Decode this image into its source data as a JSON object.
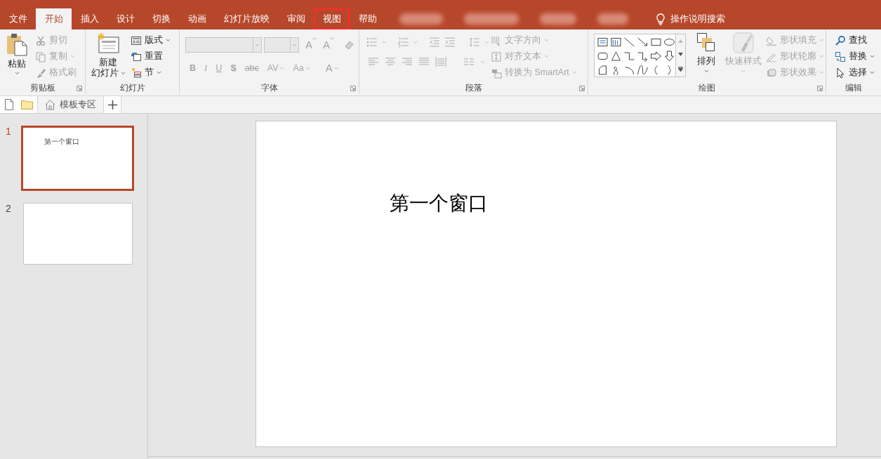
{
  "ribbon_tabs": [
    {
      "label": "文件",
      "selected": false,
      "highlighted": false
    },
    {
      "label": "开始",
      "selected": true,
      "highlighted": false
    },
    {
      "label": "插入",
      "selected": false,
      "highlighted": false
    },
    {
      "label": "设计",
      "selected": false,
      "highlighted": false
    },
    {
      "label": "切换",
      "selected": false,
      "highlighted": false
    },
    {
      "label": "动画",
      "selected": false,
      "highlighted": false
    },
    {
      "label": "幻灯片放映",
      "selected": false,
      "highlighted": false
    },
    {
      "label": "审阅",
      "selected": false,
      "highlighted": false
    },
    {
      "label": "视图",
      "selected": false,
      "highlighted": true
    },
    {
      "label": "帮助",
      "selected": false,
      "highlighted": false
    }
  ],
  "tell_me": "操作说明搜索",
  "clipboard": {
    "label": "剪贴板",
    "paste": "粘贴",
    "items": [
      {
        "label": "剪切",
        "kind": "scissors",
        "disabled": true,
        "dropdown": false
      },
      {
        "label": "复制",
        "kind": "copy",
        "disabled": true,
        "dropdown": true
      },
      {
        "label": "格式刷",
        "kind": "brush",
        "disabled": true,
        "dropdown": false
      }
    ]
  },
  "slides_group": {
    "label": "幻灯片",
    "new_slide": [
      "新建",
      "幻灯片"
    ],
    "items": [
      {
        "label": "版式",
        "kind": "layout",
        "disabled": false,
        "dropdown": true
      },
      {
        "label": "重置",
        "kind": "reset",
        "disabled": false,
        "dropdown": false
      },
      {
        "label": "节",
        "kind": "section",
        "disabled": false,
        "dropdown": true
      }
    ]
  },
  "font_group": {
    "label": "字体",
    "format_buttons": [
      {
        "label": "B",
        "kind": "bold"
      },
      {
        "label": "I",
        "kind": "italic"
      },
      {
        "label": "U",
        "kind": "underline"
      },
      {
        "label": "S",
        "kind": "shadow"
      },
      {
        "label": "abc",
        "kind": "strike"
      },
      {
        "label": "AV",
        "kind": "spacing"
      },
      {
        "label": "Aa",
        "kind": "case"
      },
      {
        "label": "A",
        "kind": "color"
      }
    ],
    "size_buttons": [
      "A",
      "A"
    ]
  },
  "paragraph_group": {
    "label": "段落",
    "items": [
      {
        "label": "文字方向",
        "kind": "direction",
        "disabled": true
      },
      {
        "label": "对齐文本",
        "kind": "align",
        "disabled": true
      },
      {
        "label": "转换为 SmartArt",
        "kind": "smartart",
        "disabled": true
      }
    ]
  },
  "drawing_group": {
    "label": "绘图",
    "arrange": "排列",
    "quick_styles": "快速样式",
    "quick_styles_disabled": true,
    "items": [
      {
        "label": "形状填充",
        "kind": "fill",
        "disabled": true
      },
      {
        "label": "形状轮廓",
        "kind": "outline",
        "disabled": true
      },
      {
        "label": "形状效果",
        "kind": "effect",
        "disabled": true
      }
    ]
  },
  "editing_group": {
    "label": "编辑",
    "items": [
      {
        "label": "查找",
        "kind": "search",
        "dropdown": false
      },
      {
        "label": "替换",
        "kind": "replace",
        "dropdown": true
      },
      {
        "label": "选择",
        "kind": "cursor",
        "dropdown": true
      }
    ]
  },
  "doc_tabs": [
    {
      "label": "模板专区",
      "selected": false
    }
  ],
  "slides": [
    {
      "number": "1",
      "selected": true,
      "title": "第一个窗口"
    },
    {
      "number": "2",
      "selected": false
    }
  ],
  "slide_canvas": {
    "title": "第一个窗口"
  }
}
